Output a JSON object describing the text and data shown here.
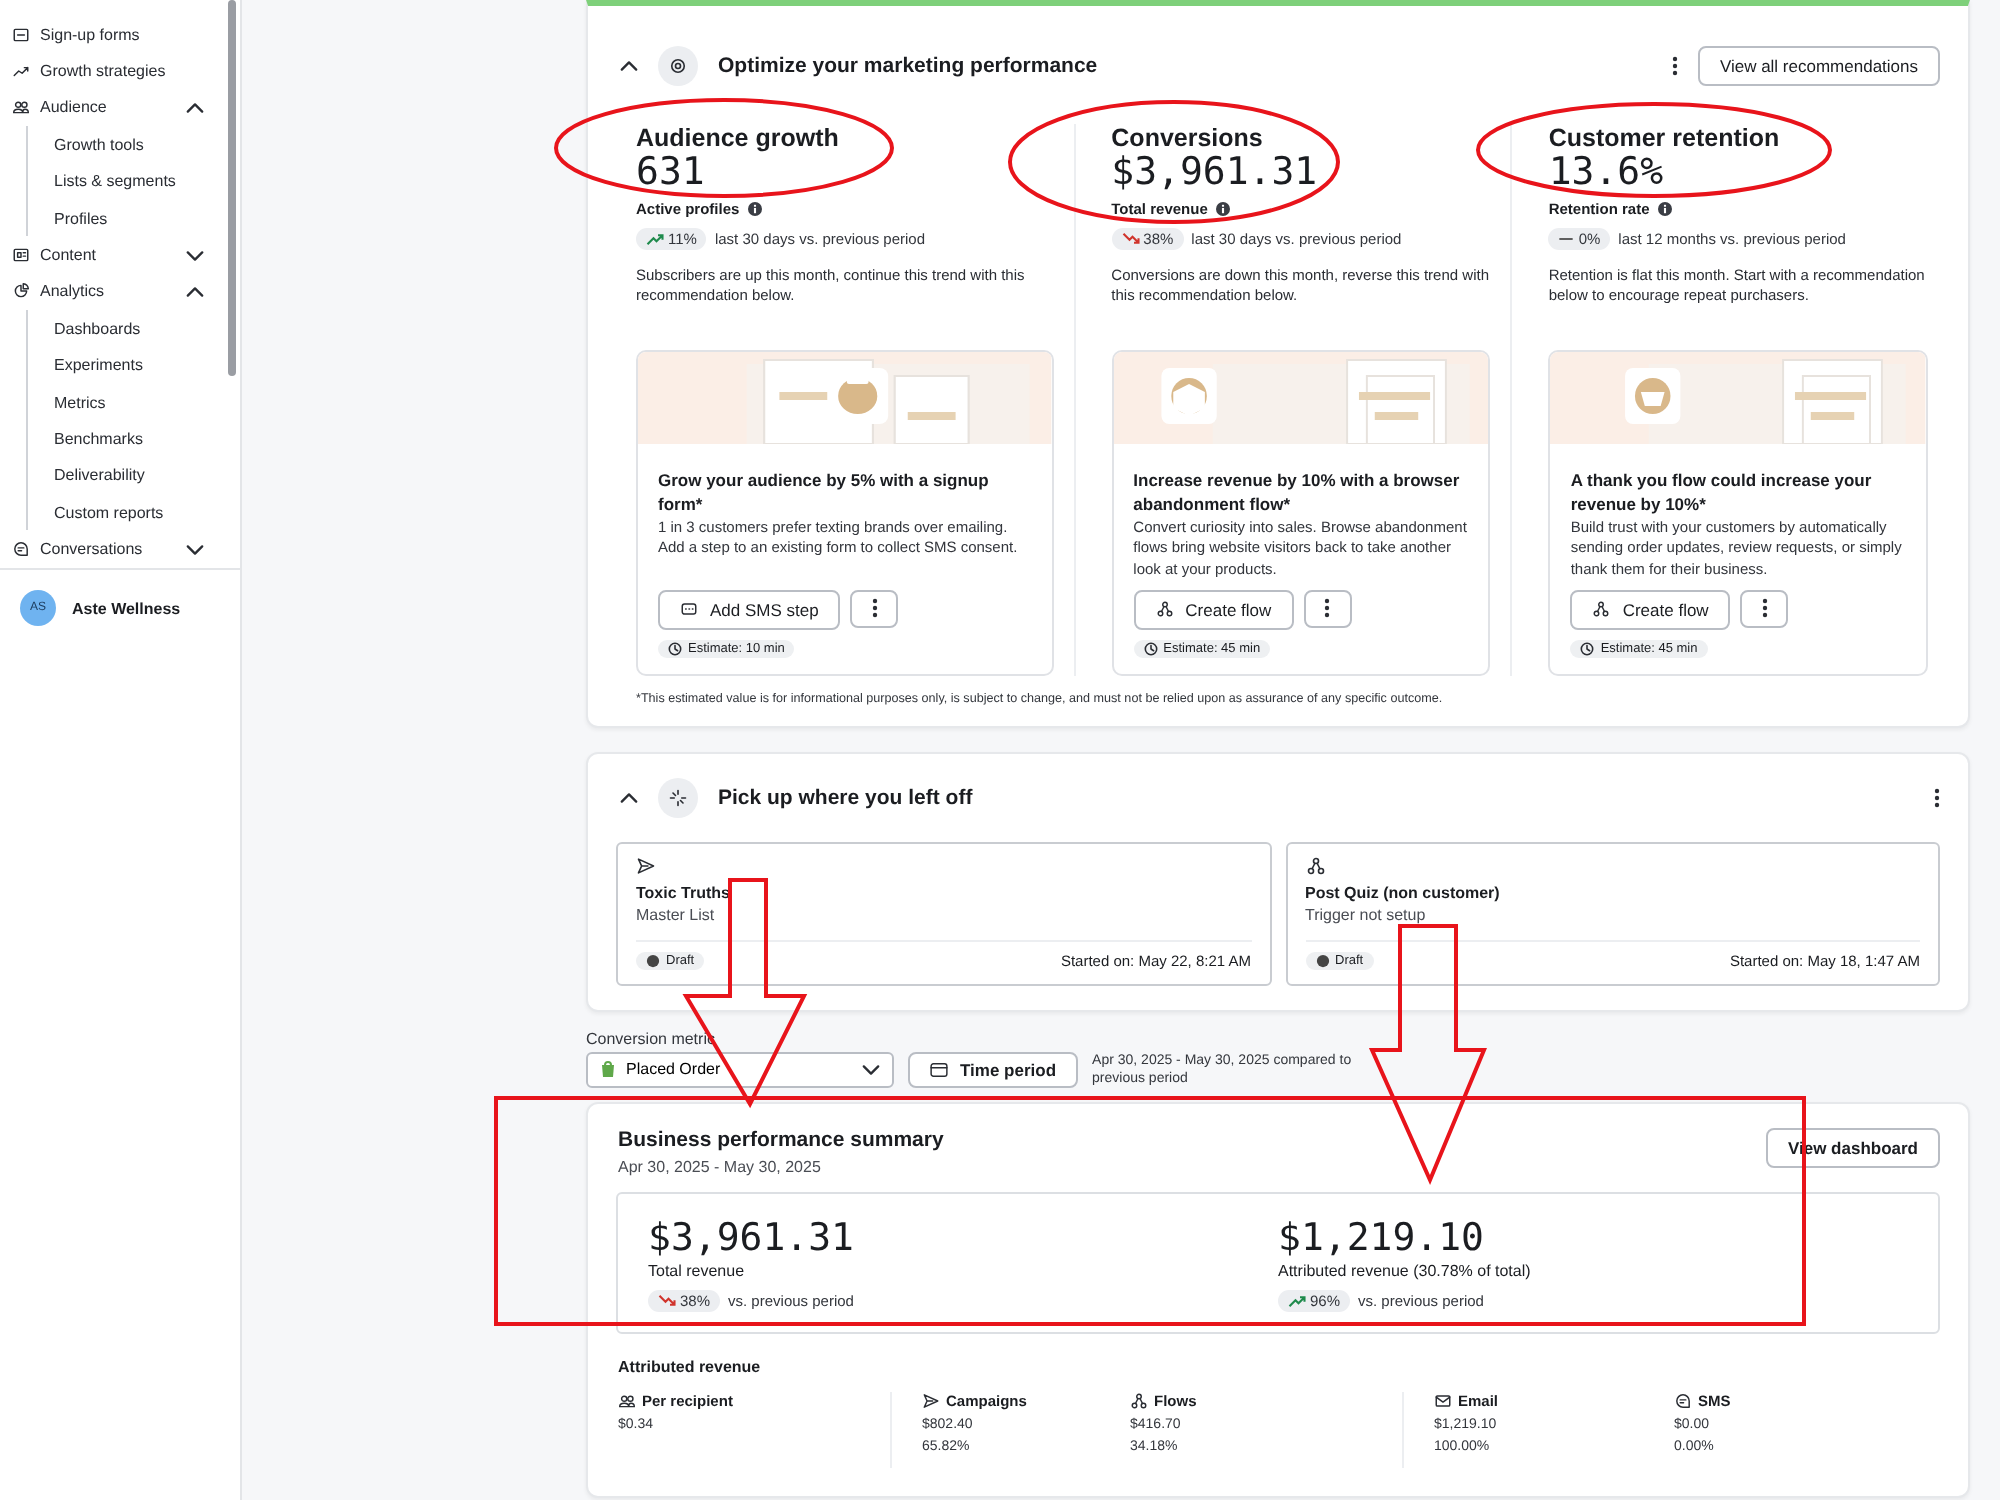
{
  "sidebar": {
    "items": [
      {
        "label": "Sign-up forms",
        "kind": "form"
      },
      {
        "label": "Growth strategies",
        "kind": "trend"
      },
      {
        "label": "Audience",
        "kind": "people",
        "expanded": true,
        "children": [
          {
            "label": "Growth tools"
          },
          {
            "label": "Lists & segments"
          },
          {
            "label": "Profiles"
          }
        ]
      },
      {
        "label": "Content",
        "kind": "content",
        "expanded": false
      },
      {
        "label": "Analytics",
        "kind": "chart",
        "expanded": true,
        "children": [
          {
            "label": "Dashboards"
          },
          {
            "label": "Experiments"
          },
          {
            "label": "Metrics"
          },
          {
            "label": "Benchmarks"
          },
          {
            "label": "Deliverability"
          },
          {
            "label": "Custom reports"
          }
        ]
      },
      {
        "label": "Conversations",
        "kind": "chat",
        "expanded": false
      }
    ],
    "account": {
      "initials": "AS",
      "name": "Aste Wellness"
    }
  },
  "recommendations": {
    "title": "Optimize your marketing performance",
    "expanded": true,
    "button": "View all recommendations",
    "metrics": [
      {
        "title": "Audience growth",
        "value": "631",
        "label": "Active profiles",
        "change": {
          "kind": "up",
          "text": "11%"
        },
        "period": "last 30 days vs. previous period",
        "description": "Subscribers are up this month, continue this trend with this recommendation below.",
        "rec": {
          "title": "Grow your audience by 5% with a signup form*",
          "body": "1 in 3 customers prefer texting brands over emailing. Add a step to an existing form to collect SMS consent.",
          "action": {
            "kind": "sms",
            "label": "Add SMS step"
          },
          "estimate": "Estimate: 10 min"
        }
      },
      {
        "title": "Conversions",
        "value": "$3,961.31",
        "label": "Total revenue",
        "change": {
          "kind": "down",
          "text": "38%"
        },
        "period": "last 30 days vs. previous period",
        "description": "Conversions are down this month, reverse this trend with this recommendation below.",
        "rec": {
          "title": "Increase revenue by 10% with a browser abandonment flow*",
          "body": "Convert curiosity into sales. Browse abandonment flows bring website visitors back to take another look at your products.",
          "action": {
            "kind": "flow",
            "label": "Create flow"
          },
          "estimate": "Estimate: 45 min"
        }
      },
      {
        "title": "Customer retention",
        "value": "13.6%",
        "label": "Retention rate",
        "change": {
          "kind": "flat",
          "text": "0%"
        },
        "period": "last 12 months vs. previous period",
        "description": "Retention is flat this month. Start with a recommendation below to encourage repeat purchasers.",
        "rec": {
          "title": "A thank you flow could increase your revenue by 10%*",
          "body": "Build trust with your customers by automatically sending order updates, review requests, or simply thank them for their business.",
          "action": {
            "kind": "flow",
            "label": "Create flow"
          },
          "estimate": "Estimate: 45 min"
        }
      }
    ],
    "footnote": "*This estimated value is for informational purposes only, is subject to change, and must not be relied upon as assurance of any specific outcome."
  },
  "pickup": {
    "title": "Pick up where you left off",
    "expanded": true,
    "items": [
      {
        "kind": "send",
        "title": "Toxic Truths",
        "subtitle": "Master List",
        "status": "Draft",
        "started": "Started on: May 22, 8:21 AM"
      },
      {
        "kind": "flow",
        "title": "Post Quiz (non customer)",
        "subtitle": "Trigger not setup",
        "status": "Draft",
        "started": "Started on: May 18, 1:47 AM"
      }
    ]
  },
  "filters": {
    "label": "Conversion metric",
    "metric": "Placed Order",
    "time_button": "Time period",
    "range": "Apr 30, 2025 - May 30, 2025 compared to previous period"
  },
  "summary": {
    "title": "Business performance summary",
    "dates": "Apr 30, 2025 - May 30, 2025",
    "button": "View dashboard",
    "stats": [
      {
        "value": "$3,961.31",
        "label": "Total revenue",
        "change": {
          "kind": "down",
          "text": "38%"
        },
        "period": "vs. previous period"
      },
      {
        "value": "$1,219.10",
        "label": "Attributed revenue (30.78% of total)",
        "change": {
          "kind": "up",
          "text": "96%"
        },
        "period": "vs. previous period"
      }
    ],
    "attributed_title": "Attributed revenue",
    "breakdown": [
      {
        "kind": "people",
        "label": "Per recipient",
        "values": [
          "$0.34"
        ]
      },
      {
        "kind": "send",
        "label": "Campaigns",
        "values": [
          "$802.40",
          "65.82%"
        ]
      },
      {
        "kind": "flow",
        "label": "Flows",
        "values": [
          "$416.70",
          "34.18%"
        ]
      },
      {
        "kind": "mail",
        "label": "Email",
        "values": [
          "$1,219.10",
          "100.00%"
        ]
      },
      {
        "kind": "chat",
        "label": "SMS",
        "values": [
          "$0.00",
          "0.00%"
        ]
      }
    ]
  },
  "annotations": [
    {
      "kind": "ellipse"
    },
    {
      "kind": "ellipse"
    },
    {
      "kind": "ellipse"
    },
    {
      "kind": "arrow"
    },
    {
      "kind": "arrow"
    },
    {
      "kind": "frame"
    }
  ]
}
